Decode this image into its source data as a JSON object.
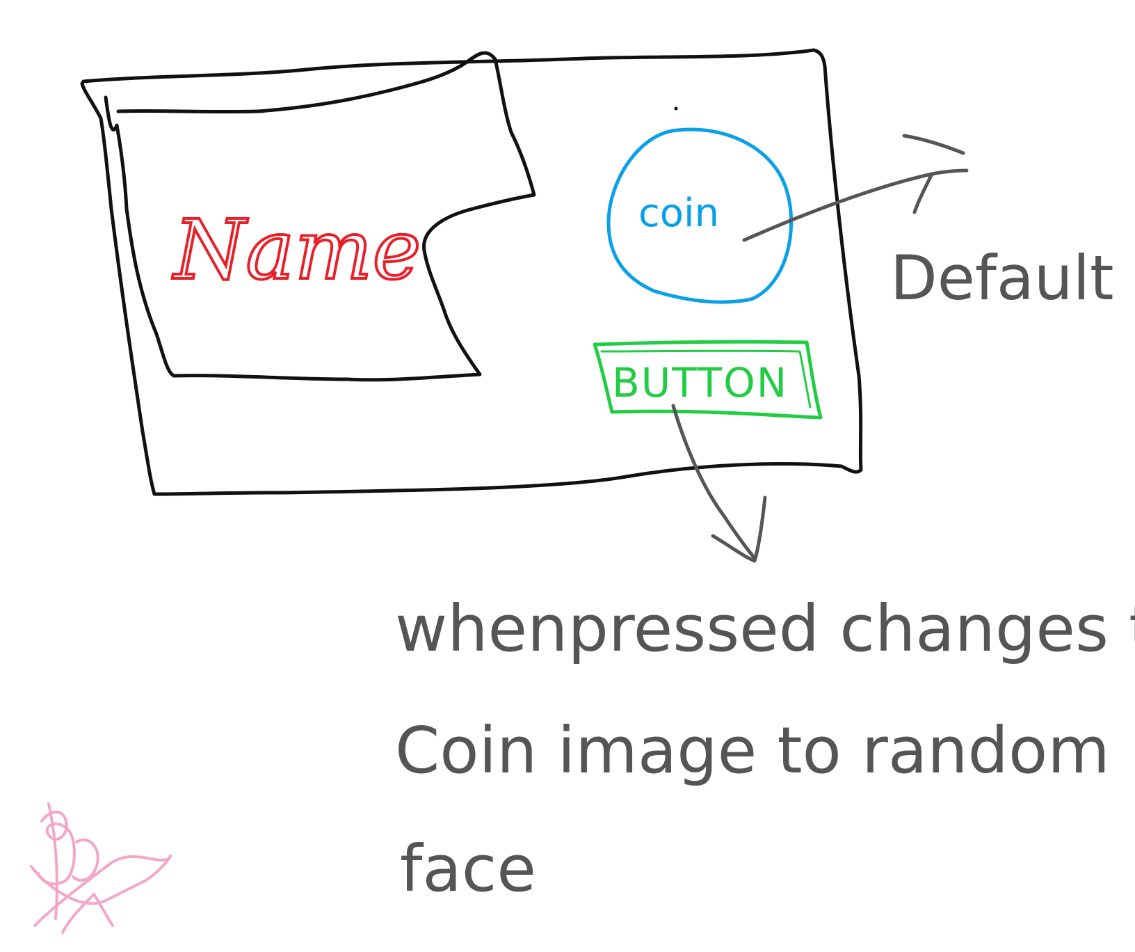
{
  "colors": {
    "outline": "#111111",
    "name": "#e8202a",
    "coin": "#0aa0e8",
    "button": "#22cc44",
    "annotation": "#555555",
    "signature": "#f4a6c8"
  },
  "window": {
    "name_label": "Name",
    "coin_label": "coin",
    "button_label": "BUTTON"
  },
  "annotations": {
    "default_label": "Default",
    "note_line1": "whenpressed changes the",
    "note_line2": "Coin image to random",
    "note_line3": "face"
  },
  "signature": {
    "icon": "signature-icon"
  }
}
